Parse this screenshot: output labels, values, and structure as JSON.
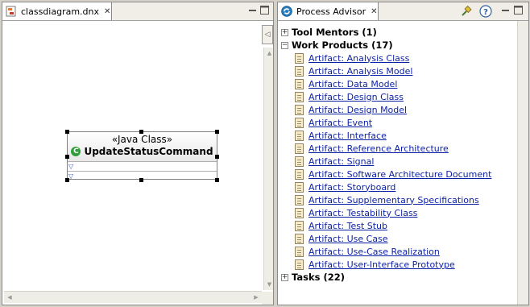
{
  "editor": {
    "tab_label": "classdiagram.dnx",
    "tab_icon": "diagram-file-icon"
  },
  "class_box": {
    "stereotype": "«Java Class»",
    "name": "UpdateStatusCommand",
    "icon": "class-c-icon"
  },
  "advisor": {
    "tab_label": "Process Advisor",
    "tab_icon": "process-advisor-icon",
    "toolbar": [
      "pin-icon",
      "help-icon"
    ],
    "tool_mentors": "Tool Mentors (1)",
    "work_products": "Work Products (17)",
    "tasks": "Tasks (22)",
    "artifacts": [
      "Artifact: Analysis Class",
      "Artifact: Analysis Model",
      "Artifact: Data Model",
      "Artifact: Design Class",
      "Artifact: Design Model",
      "Artifact: Event",
      "Artifact: Interface",
      "Artifact: Reference Architecture",
      "Artifact: Signal",
      "Artifact: Software Architecture Document",
      "Artifact: Storyboard",
      "Artifact: Supplementary Specifications",
      "Artifact: Testability Class",
      "Artifact: Test Stub",
      "Artifact: Use Case",
      "Artifact: Use-Case Realization",
      "Artifact: User-Interface Prototype"
    ]
  },
  "colors": {
    "link": "#0a1fa5",
    "class_icon": "#2f9e3b",
    "chrome": "#d4d0c8"
  }
}
